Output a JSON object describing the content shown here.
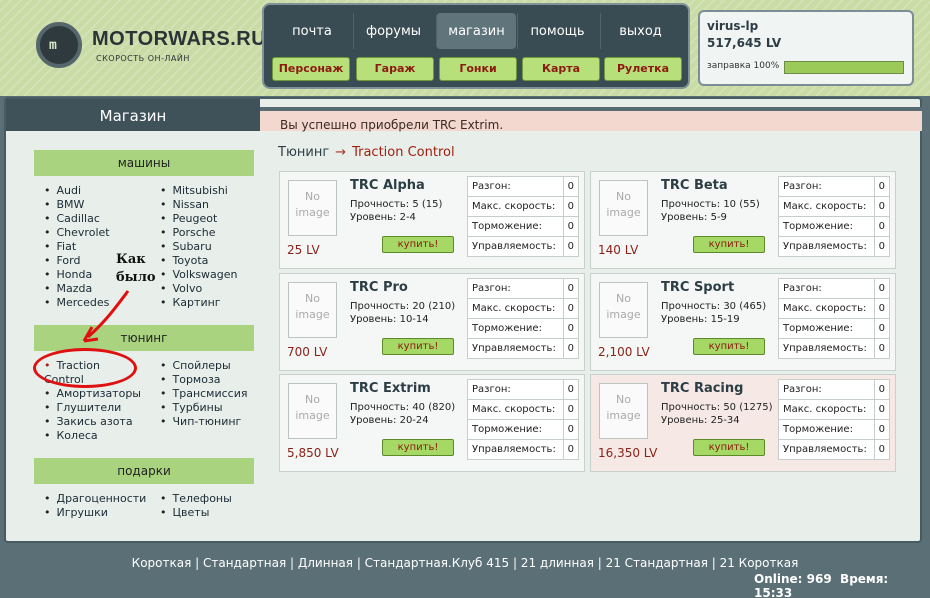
{
  "header": {
    "brand": "MOTORWARS.RU",
    "tagline": "СКОРОСТЬ ОН-ЛАЙН",
    "logo_mark": "m"
  },
  "nav": {
    "tabs": [
      "почта",
      "форумы",
      "магазин",
      "помощь",
      "выход"
    ],
    "buttons": [
      "Персонаж",
      "Гараж",
      "Гонки",
      "Карта",
      "Рулетка"
    ]
  },
  "user": {
    "name": "virus-lp",
    "money": "517,645 LV",
    "fuel": "заправка 100%"
  },
  "sidebar": {
    "title": "Магазин",
    "sections": [
      {
        "title": "машины",
        "col1": [
          "Audi",
          "BMW",
          "Cadillac",
          "Chevrolet",
          "Fiat",
          "Ford",
          "Honda",
          "Mazda",
          "Mercedes"
        ],
        "col2": [
          "Mitsubishi",
          "Nissan",
          "Peugeot",
          "Porsche",
          "Subaru",
          "Toyota",
          "Volkswagen",
          "Volvo",
          "Картинг"
        ]
      },
      {
        "title": "тюнинг",
        "col1": [
          "Traction Control",
          "Амортизаторы",
          "Глушители",
          "Закись азота",
          "Колеса"
        ],
        "col2": [
          "Спойлеры",
          "Тормоза",
          "Трансмиссия",
          "Турбины",
          "Чип-тюнинг"
        ]
      },
      {
        "title": "подарки",
        "col1": [
          "Драгоценности",
          "Игрушки"
        ],
        "col2": [
          "Телефоны",
          "Цветы"
        ]
      }
    ],
    "annotation": "Как было"
  },
  "message": "Вы успешно приобрели TRC Extrim.",
  "breadcrumb": {
    "parent": "Тюнинг",
    "arrow": "→",
    "current": "Traction Control"
  },
  "stat_labels": [
    "Разгон:",
    "Макс. скорость:",
    "Торможение:",
    "Управляемость:"
  ],
  "products": [
    {
      "name": "TRC Alpha",
      "durability": "Прочность: 5 (15)",
      "level": "Уровень: 2-4",
      "price": "25 LV",
      "stats": [
        "0",
        "0",
        "0",
        "0"
      ],
      "image": "No image",
      "buy": "купить!"
    },
    {
      "name": "TRC Beta",
      "durability": "Прочность: 10 (55)",
      "level": "Уровень: 5-9",
      "price": "140 LV",
      "stats": [
        "0",
        "0",
        "0",
        "0"
      ],
      "image": "No image",
      "buy": "купить!"
    },
    {
      "name": "TRC Pro",
      "durability": "Прочность: 20 (210)",
      "level": "Уровень: 10-14",
      "price": "700 LV",
      "stats": [
        "0",
        "0",
        "0",
        "0"
      ],
      "image": "No image",
      "buy": "купить!"
    },
    {
      "name": "TRC Sport",
      "durability": "Прочность: 30 (465)",
      "level": "Уровень: 15-19",
      "price": "2,100 LV",
      "stats": [
        "0",
        "0",
        "0",
        "0"
      ],
      "image": "No image",
      "buy": "купить!"
    },
    {
      "name": "TRC Extrim",
      "durability": "Прочность: 40 (820)",
      "level": "Уровень: 20-24",
      "price": "5,850 LV",
      "stats": [
        "0",
        "0",
        "0",
        "0"
      ],
      "image": "No image",
      "buy": "купить!"
    },
    {
      "name": "TRC Racing",
      "durability": "Прочность: 50 (1275)",
      "level": "Уровень: 25-34",
      "price": "16,350 LV",
      "stats": [
        "0",
        "0",
        "0",
        "0"
      ],
      "image": "No image",
      "buy": "купить!"
    }
  ],
  "footer": {
    "links": "Короткая | Стандартная | Длинная | Стандартная.Клуб 415 | 21 длинная | 21 Стандартная | 21 Короткая",
    "online": "Online: 969",
    "time": "Время: 15:33"
  }
}
